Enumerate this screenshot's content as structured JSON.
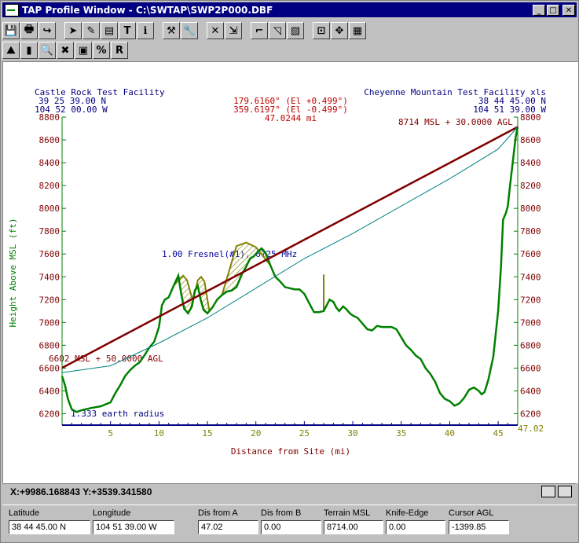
{
  "window": {
    "title": "TAP Profile Window - C:\\SWTAP\\SWP2P000.DBF",
    "minimize": "_",
    "maximize": "□",
    "close": "✕"
  },
  "toolbar1": [
    {
      "name": "save-icon",
      "glyph": "💾"
    },
    {
      "name": "print-icon",
      "glyph": "🖶"
    },
    {
      "name": "redo-icon",
      "glyph": "↪"
    },
    {
      "name": "pointer-icon",
      "glyph": "➤"
    },
    {
      "name": "draw-icon",
      "glyph": "✎"
    },
    {
      "name": "stack-icon",
      "glyph": "▤"
    },
    {
      "name": "text-icon",
      "glyph": "T"
    },
    {
      "name": "info-icon",
      "glyph": "ℹ"
    },
    {
      "name": "tools-icon",
      "glyph": "⚒"
    },
    {
      "name": "wrench-icon",
      "glyph": "🔧"
    },
    {
      "name": "delete-icon",
      "glyph": "✕"
    },
    {
      "name": "export-icon",
      "glyph": "⇲"
    },
    {
      "name": "terrain-icon",
      "glyph": "⌐"
    },
    {
      "name": "area-icon",
      "glyph": "◹"
    },
    {
      "name": "hatch-icon",
      "glyph": "▧"
    },
    {
      "name": "zoom-icon",
      "glyph": "⊡"
    },
    {
      "name": "move-icon",
      "glyph": "✥"
    },
    {
      "name": "colors-icon",
      "glyph": "▦"
    }
  ],
  "toolbar2": [
    {
      "name": "profile-icon",
      "glyph": "⛰"
    },
    {
      "name": "site-icon",
      "glyph": "▮"
    },
    {
      "name": "search-icon",
      "glyph": "🔍"
    },
    {
      "name": "cancel-icon",
      "glyph": "✖"
    },
    {
      "name": "map-icon",
      "glyph": "▣"
    },
    {
      "name": "percent-icon",
      "glyph": "%"
    },
    {
      "name": "radius-icon",
      "glyph": "R"
    }
  ],
  "plot": {
    "site_a_name": "Castle Rock Test Facility",
    "site_a_lat": "39 25 39.00 N",
    "site_a_lon": "104 52 00.00 W",
    "site_b_name": "Cheyenne Mountain Test Facility xls",
    "site_b_lat": "38 44 45.00 N",
    "site_b_lon": "104 51 39.00 W",
    "azimuth_1": "179.6160° (El +0.499°)",
    "azimuth_2": "359.6197° (El -0.499°)",
    "path_distance": "47.0244 mi",
    "end_label": "8714 MSL + 30.0000 AGL",
    "start_label": "6602 MSL + 50.0000 AGL",
    "fresnel_label": "1.00 Fresnel(#1), 6725 MHz",
    "earth_radius_label": "1.333 earth radius",
    "y_axis_label": "Height Above MSL (ft)",
    "x_axis_label": "Distance from Site (mi)",
    "x_max_label": "47.02"
  },
  "chart_data": {
    "type": "line",
    "xlabel": "Distance from Site (mi)",
    "ylabel": "Height Above MSL (ft)",
    "xlim": [
      0,
      47.02
    ],
    "ylim": [
      6100,
      8800
    ],
    "x_ticks": [
      5,
      10,
      15,
      20,
      25,
      30,
      35,
      40,
      45
    ],
    "y_ticks": [
      6200,
      6400,
      6600,
      6800,
      7000,
      7200,
      7400,
      7600,
      7800,
      8000,
      8200,
      8400,
      8600,
      8800
    ],
    "series": [
      {
        "color": "#008000",
        "points": [
          [
            0,
            6530
          ],
          [
            0.3,
            6450
          ],
          [
            0.6,
            6330
          ],
          [
            1,
            6240
          ],
          [
            1.5,
            6215
          ],
          [
            2,
            6230
          ],
          [
            3,
            6250
          ],
          [
            4,
            6265
          ],
          [
            5,
            6300
          ],
          [
            5.5,
            6380
          ],
          [
            6,
            6450
          ],
          [
            6.5,
            6530
          ],
          [
            7,
            6580
          ],
          [
            7.5,
            6620
          ],
          [
            8,
            6650
          ],
          [
            8.5,
            6710
          ],
          [
            9,
            6780
          ],
          [
            9.5,
            6830
          ],
          [
            10,
            6960
          ],
          [
            10.3,
            7150
          ],
          [
            10.6,
            7200
          ],
          [
            11,
            7220
          ],
          [
            11.5,
            7320
          ],
          [
            12,
            7410
          ],
          [
            12.3,
            7250
          ],
          [
            12.6,
            7120
          ],
          [
            13,
            7080
          ],
          [
            13.4,
            7140
          ],
          [
            13.7,
            7280
          ],
          [
            14,
            7320
          ],
          [
            14.3,
            7200
          ],
          [
            14.6,
            7110
          ],
          [
            15,
            7080
          ],
          [
            15.5,
            7130
          ],
          [
            16,
            7200
          ],
          [
            16.5,
            7240
          ],
          [
            17,
            7270
          ],
          [
            17.5,
            7280
          ],
          [
            18,
            7310
          ],
          [
            18.3,
            7370
          ],
          [
            18.6,
            7430
          ],
          [
            19,
            7490
          ],
          [
            19.4,
            7560
          ],
          [
            19.8,
            7580
          ],
          [
            20.2,
            7620
          ],
          [
            20.6,
            7650
          ],
          [
            21,
            7610
          ],
          [
            21.5,
            7500
          ],
          [
            22,
            7400
          ],
          [
            22.5,
            7360
          ],
          [
            23,
            7310
          ],
          [
            23.5,
            7300
          ],
          [
            24,
            7290
          ],
          [
            24.5,
            7290
          ],
          [
            25,
            7250
          ],
          [
            25.5,
            7170
          ],
          [
            26,
            7090
          ],
          [
            26.5,
            7090
          ],
          [
            27,
            7100
          ],
          [
            27.3,
            7150
          ],
          [
            27.6,
            7200
          ],
          [
            28,
            7180
          ],
          [
            28.3,
            7130
          ],
          [
            28.6,
            7100
          ],
          [
            29,
            7140
          ],
          [
            29.3,
            7120
          ],
          [
            29.7,
            7080
          ],
          [
            30,
            7060
          ],
          [
            30.5,
            7040
          ],
          [
            31,
            6990
          ],
          [
            31.5,
            6940
          ],
          [
            32,
            6930
          ],
          [
            32.5,
            6970
          ],
          [
            33,
            6960
          ],
          [
            34,
            6960
          ],
          [
            34.5,
            6940
          ],
          [
            35,
            6870
          ],
          [
            35.5,
            6800
          ],
          [
            36,
            6760
          ],
          [
            36.5,
            6710
          ],
          [
            37,
            6680
          ],
          [
            37.5,
            6600
          ],
          [
            38,
            6550
          ],
          [
            38.5,
            6480
          ],
          [
            39,
            6380
          ],
          [
            39.5,
            6330
          ],
          [
            40,
            6310
          ],
          [
            40.5,
            6270
          ],
          [
            41,
            6290
          ],
          [
            41.5,
            6340
          ],
          [
            42,
            6410
          ],
          [
            42.5,
            6430
          ],
          [
            43,
            6400
          ],
          [
            43.3,
            6370
          ],
          [
            43.6,
            6390
          ],
          [
            44,
            6500
          ],
          [
            44.5,
            6700
          ],
          [
            45,
            7100
          ],
          [
            45.3,
            7500
          ],
          [
            45.5,
            7900
          ],
          [
            45.8,
            7960
          ],
          [
            46,
            8020
          ],
          [
            46.2,
            8180
          ],
          [
            46.5,
            8400
          ],
          [
            46.8,
            8620
          ],
          [
            47.02,
            8714
          ]
        ]
      },
      {
        "color": "#800000",
        "points": [
          [
            0,
            6602
          ],
          [
            47.02,
            8714
          ]
        ]
      },
      {
        "color": "#008080",
        "points": [
          [
            0,
            6560
          ],
          [
            5,
            6620
          ],
          [
            10,
            6820
          ],
          [
            15,
            7040
          ],
          [
            20,
            7300
          ],
          [
            25,
            7560
          ],
          [
            30,
            7780
          ],
          [
            35,
            8020
          ],
          [
            40,
            8260
          ],
          [
            45,
            8520
          ],
          [
            47.02,
            8714
          ]
        ]
      }
    ],
    "obstructions": [
      {
        "x": [
          11.5,
          13.5
        ],
        "peak": 7410,
        "color": "#808000"
      },
      {
        "x": [
          13.5,
          15.2
        ],
        "peak": 7400,
        "color": "#808000"
      },
      {
        "x": [
          16.5,
          21.5
        ],
        "peak": 7700,
        "color": "#808000"
      }
    ],
    "knife_edge": {
      "x": 27.0,
      "from": 7100,
      "to": 7420,
      "color": "#808000"
    }
  },
  "status": {
    "coords": "X:+9986.168843 Y:+3539.341580"
  },
  "fields": {
    "latitude_label": "Latitude",
    "latitude_value": "38 44 45.00 N",
    "longitude_label": "Longitude",
    "longitude_value": "104 51 39.00 W",
    "dis_a_label": "Dis from A",
    "dis_a_value": "47.02",
    "dis_b_label": "Dis from B",
    "dis_b_value": "0.00",
    "terrain_label": "Terrain MSL",
    "terrain_value": "8714.00",
    "knife_label": "Knife-Edge",
    "knife_value": "0.00",
    "cursor_label": "Cursor AGL",
    "cursor_value": "-1399.85"
  }
}
